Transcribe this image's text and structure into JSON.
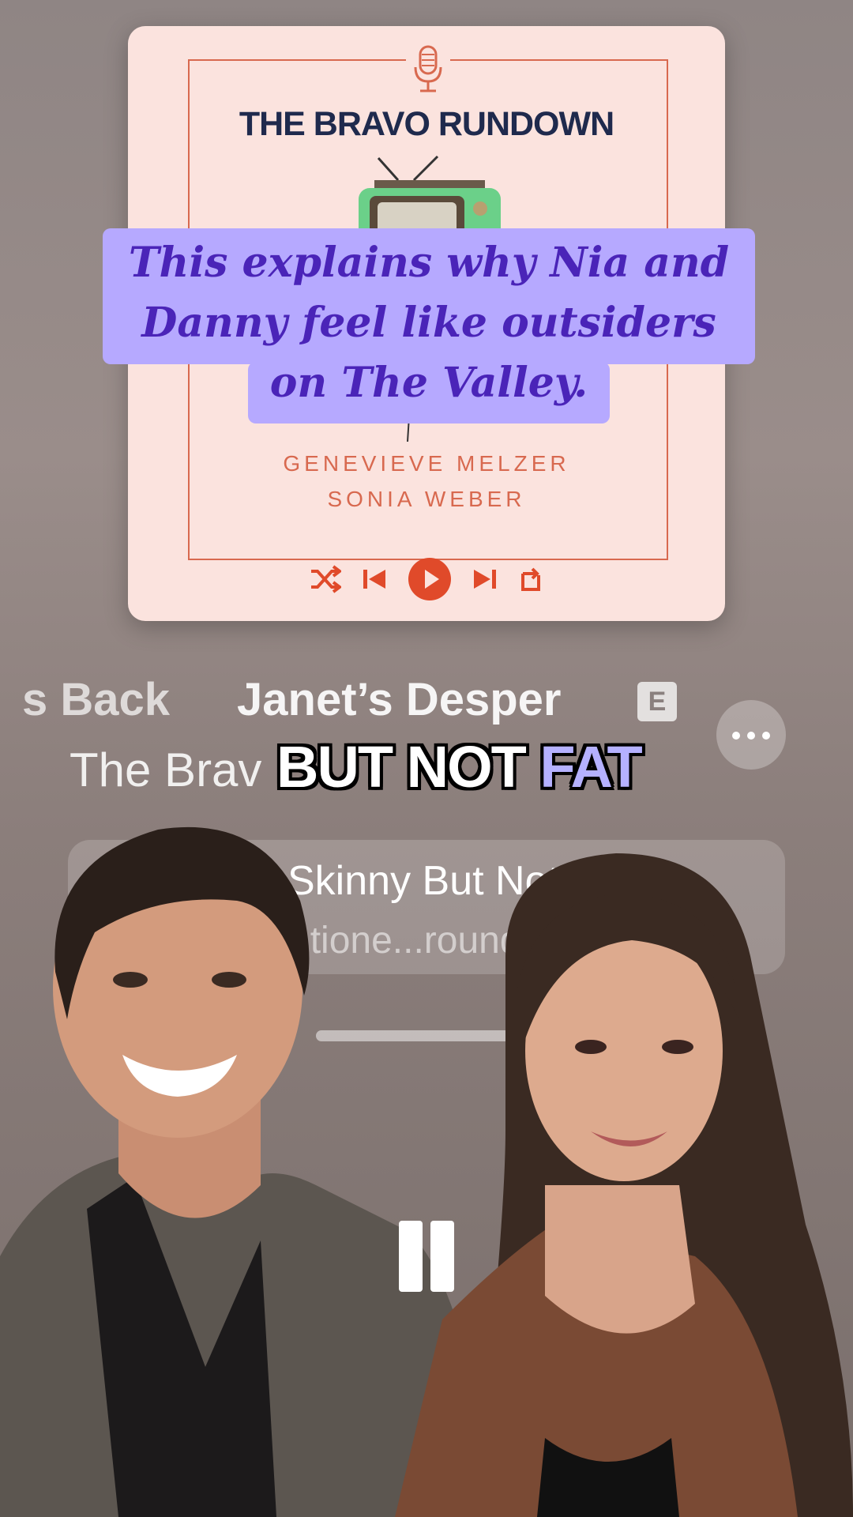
{
  "artwork": {
    "title": "THE BRAVO RUNDOWN",
    "hosts": [
      "GENEVIEVE MELZER",
      "SONIA WEBER"
    ],
    "controls": [
      "shuffle-icon",
      "previous-icon",
      "play-icon",
      "next-icon",
      "repeat-icon"
    ],
    "accent": "#d8694f",
    "background": "#fbe3de"
  },
  "caption": {
    "lines": [
      "This explains why Nia and",
      "Danny feel like outsiders",
      "on The Valley."
    ],
    "background": "#b6a9ff",
    "color": "#4a24b8"
  },
  "now_playing": {
    "episode_left_fragment": "s Back",
    "episode_title_fragment": "Janet’s Desper",
    "explicit_badge": "E",
    "show_fragment": "The Brav",
    "more_icon": "ellipsis-icon"
  },
  "subtitle": {
    "word1": "BUT NOT",
    "word2": "FAT",
    "highlight_color": "#b5b1ff"
  },
  "chapter": {
    "title_fragment": "Skinny But Not",
    "subtitle_fragment": "ntione...round"
  },
  "player": {
    "pause_icon": "pause-icon"
  }
}
